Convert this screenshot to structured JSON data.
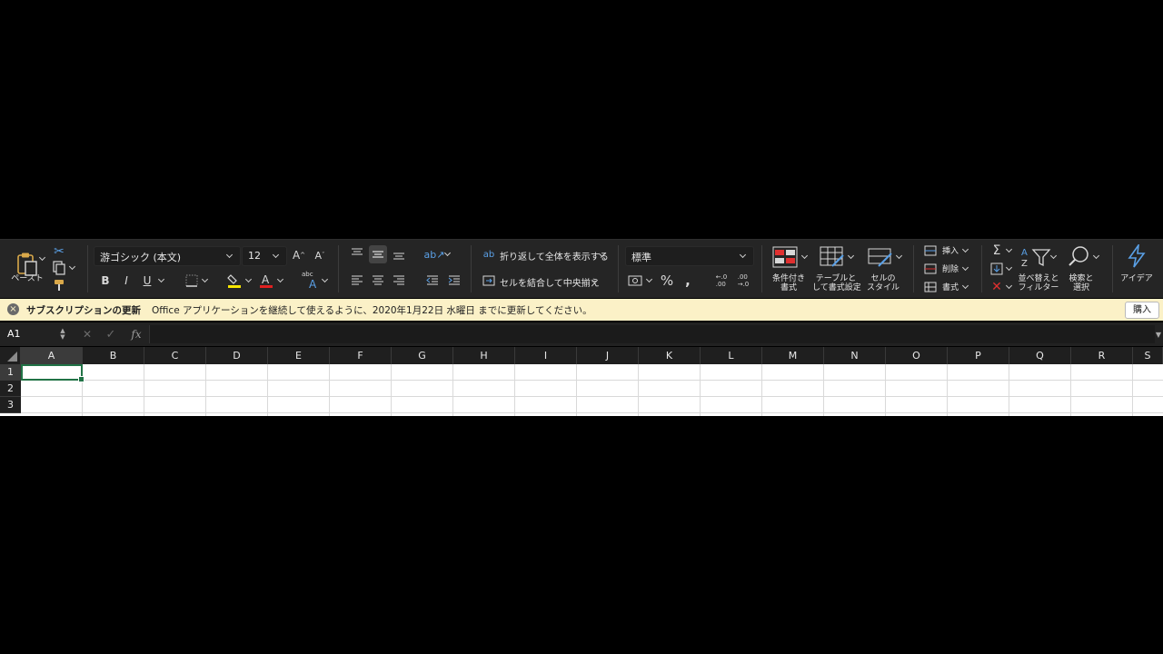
{
  "ribbon": {
    "clipboard": {
      "paste_label": "ペースト"
    },
    "font": {
      "name": "游ゴシック (本文)",
      "size": "12",
      "abc_label": "abc"
    },
    "alignment": {
      "wrap_label": "折り返して全体を表示する",
      "merge_label": "セルを結合して中央揃え"
    },
    "number": {
      "format": "標準",
      "percent": "%",
      "comma": "❟",
      "inc_decimal": ".0 .00",
      "dec_decimal": ".00 .0"
    },
    "styles": {
      "conditional_label_1": "条件付き",
      "conditional_label_2": "書式",
      "table_label_1": "テーブルと",
      "table_label_2": "して書式設定",
      "cellstyle_label_1": "セルの",
      "cellstyle_label_2": "スタイル"
    },
    "cells": {
      "insert_label": "挿入",
      "delete_label": "削除",
      "format_label": "書式"
    },
    "editing": {
      "sort_label_1": "並べ替えと",
      "sort_label_2": "フィルター",
      "find_label_1": "検索と",
      "find_label_2": "選択"
    },
    "ideas": {
      "label": "アイデア"
    },
    "colors": {
      "highlight": "#f7e600",
      "font_color": "#e02020"
    }
  },
  "notice": {
    "title": "サブスクリプションの更新",
    "message": "Office アプリケーションを継続して使えるように、2020年1月22日 水曜日 までに更新してください。",
    "buy_label": "購入"
  },
  "formula_bar": {
    "cell_ref": "A1",
    "cancel": "✕",
    "confirm": "✓",
    "fx": "fx",
    "value": ""
  },
  "grid": {
    "columns": [
      "A",
      "B",
      "C",
      "D",
      "E",
      "F",
      "G",
      "H",
      "I",
      "J",
      "K",
      "L",
      "M",
      "N",
      "O",
      "P",
      "Q",
      "R",
      "S"
    ],
    "rows": [
      "1",
      "2",
      "3"
    ],
    "active_cell": "A1"
  }
}
